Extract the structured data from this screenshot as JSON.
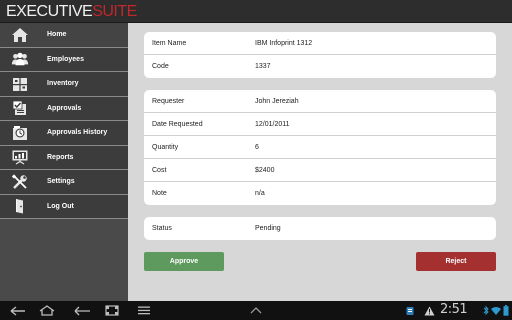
{
  "app": {
    "logo_part1": "EXECUTIVE",
    "logo_part2": "SUITE"
  },
  "sidebar": {
    "items": [
      {
        "label": "Home",
        "icon": "home-icon"
      },
      {
        "label": "Employees",
        "icon": "employees-icon"
      },
      {
        "label": "Inventory",
        "icon": "inventory-icon"
      },
      {
        "label": "Approvals",
        "icon": "approvals-icon"
      },
      {
        "label": "Approvals History",
        "icon": "approvals-history-icon"
      },
      {
        "label": "Reports",
        "icon": "reports-icon"
      },
      {
        "label": "Settings",
        "icon": "settings-icon"
      },
      {
        "label": "Log Out",
        "icon": "logout-icon"
      }
    ]
  },
  "item": {
    "name_label": "Item Name",
    "name_value": "IBM Infoprint 1312",
    "code_label": "Code",
    "code_value": "1337"
  },
  "request": {
    "requester_label": "Requester",
    "requester_value": "John Jereziah",
    "date_label": "Date Requested",
    "date_value": "12/01/2011",
    "quantity_label": "Quantity",
    "quantity_value": "6",
    "cost_label": "Cost",
    "cost_value": "$2400",
    "note_label": "Note",
    "note_value": "n/a"
  },
  "status": {
    "label": "Status",
    "value": "Pending"
  },
  "actions": {
    "approve_label": "Approve",
    "reject_label": "Reject"
  },
  "system_bar": {
    "time": "2:51"
  },
  "colors": {
    "brand_red": "#c0262c",
    "approve_green": "#5e9a5e",
    "reject_red": "#a53030",
    "sidebar_bg": "#3c3c3c"
  }
}
